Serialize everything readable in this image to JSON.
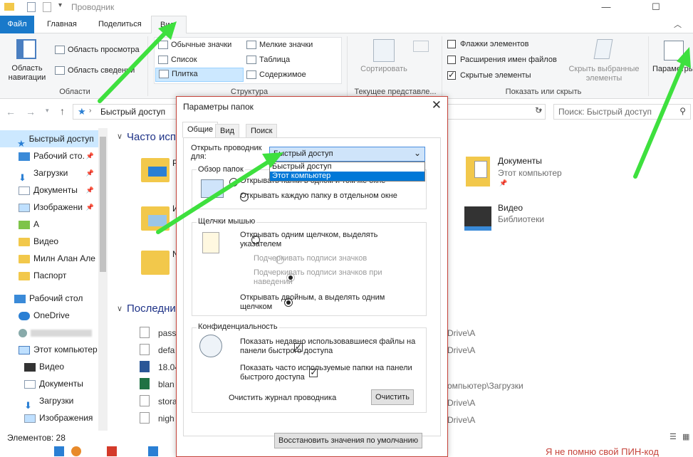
{
  "window": {
    "title": "Проводник"
  },
  "ribbon_tabs": [
    "Файл",
    "Главная",
    "Поделиться",
    "Вид"
  ],
  "ribbon": {
    "panes": {
      "nav_pane": "Область навигации",
      "preview": "Область просмотра",
      "details": "Область сведений",
      "label": "Области"
    },
    "layout": {
      "items": [
        "Обычные значки",
        "Мелкие значки",
        "Список",
        "Таблица",
        "Плитка",
        "Содержимое"
      ],
      "label": "Структура"
    },
    "current_view": {
      "sort": "Сортировать",
      "label": "Текущее представле..."
    },
    "show_hide": {
      "checkboxes": [
        {
          "label": "Флажки элементов",
          "checked": false
        },
        {
          "label": "Расширения имен файлов",
          "checked": false
        },
        {
          "label": "Скрытые элементы",
          "checked": true
        }
      ],
      "hide_selected": "Скрыть выбранные элементы",
      "label": "Показать или скрыть"
    },
    "options": "Параметры"
  },
  "address": {
    "path": "Быстрый доступ",
    "search_placeholder": "Поиск: Быстрый доступ"
  },
  "nav": {
    "items": [
      {
        "label": "Быстрый доступ",
        "icon": "star-icon",
        "pinned": false
      },
      {
        "label": "Рабочий сто.",
        "icon": "desktop-icon",
        "pinned": true
      },
      {
        "label": "Загрузки",
        "icon": "download-icon",
        "pinned": true
      },
      {
        "label": "Документы",
        "icon": "documents-icon",
        "pinned": true
      },
      {
        "label": "Изображени",
        "icon": "pictures-icon",
        "pinned": true
      },
      {
        "label": "А",
        "icon": "folder-icon",
        "pinned": false
      },
      {
        "label": "Видео",
        "icon": "video-icon",
        "pinned": false
      },
      {
        "label": "Милн Алан Але",
        "icon": "folder-icon",
        "pinned": false
      },
      {
        "label": "Паспорт",
        "icon": "folder-icon",
        "pinned": false
      },
      {
        "label": "Рабочий стол",
        "icon": "desktop-icon",
        "pinned": false
      },
      {
        "label": "OneDrive",
        "icon": "cloud-icon",
        "pinned": false
      },
      {
        "label": "",
        "icon": "user-icon",
        "pinned": false
      },
      {
        "label": "Этот компьютер",
        "icon": "computer-icon",
        "pinned": false
      },
      {
        "label": "Видео",
        "icon": "video-icon",
        "pinned": false
      },
      {
        "label": "Документы",
        "icon": "documents-icon",
        "pinned": false
      },
      {
        "label": "Загрузки",
        "icon": "download-icon",
        "pinned": false
      },
      {
        "label": "Изображения",
        "icon": "pictures-icon",
        "pinned": false
      }
    ]
  },
  "content": {
    "frequent_header": "Часто исп",
    "recent_header": "Последни",
    "right_items": [
      {
        "name": "Документы",
        "sub": "Этот компьютер"
      },
      {
        "name": "Видео",
        "sub": "Библиотеки"
      }
    ],
    "frequent_letters": [
      "Р",
      "И",
      "N"
    ],
    "recent_files": [
      "pass",
      "defa",
      "18.04",
      "blan",
      "stora",
      "nigh"
    ],
    "recent_paths": [
      "Drive\\А",
      "Drive\\А",
      "",
      "омпьютер\\Загрузки",
      "Drive\\А",
      "Drive\\А"
    ]
  },
  "status": {
    "count": "Элементов: 28"
  },
  "taskbar": {
    "text": "Я не помню свой ПИН-код"
  },
  "dialog": {
    "title": "Параметры папок",
    "tabs": [
      "Общие",
      "Вид",
      "Поиск"
    ],
    "open_explorer_label": "Открыть проводник для:",
    "dropdown_value": "Быстрый доступ",
    "dropdown_options": [
      "Быстрый доступ",
      "Этот компьютер"
    ],
    "browse_group": "Обзор папок",
    "browse_opts": [
      "Открывать папки в одном и том же окне",
      "Открывать каждую папку в отдельном окне"
    ],
    "click_group": "Щелчки мышью",
    "click_opt1": "Открывать одним щелчком, выделять указателем",
    "underline1": "Подчеркивать подписи значков",
    "underline2": "Подчеркивать подписи значков при наведении",
    "click_opt2": "Открывать двойным, а выделять одним щелчком",
    "privacy_group": "Конфиденциальность",
    "privacy_chk1": "Показать недавно использовавшиеся файлы на панели быстрого доступа",
    "privacy_chk2": "Показать часто используемые папки на панели быстрого доступа",
    "clear_label": "Очистить журнал проводника",
    "clear_button": "Очистить",
    "restore_button": "Восстановить значения по умолчанию"
  },
  "colors": {
    "accent": "#1979ca",
    "arrow": "#3ee03e",
    "dialog_border": "#c5433a"
  }
}
